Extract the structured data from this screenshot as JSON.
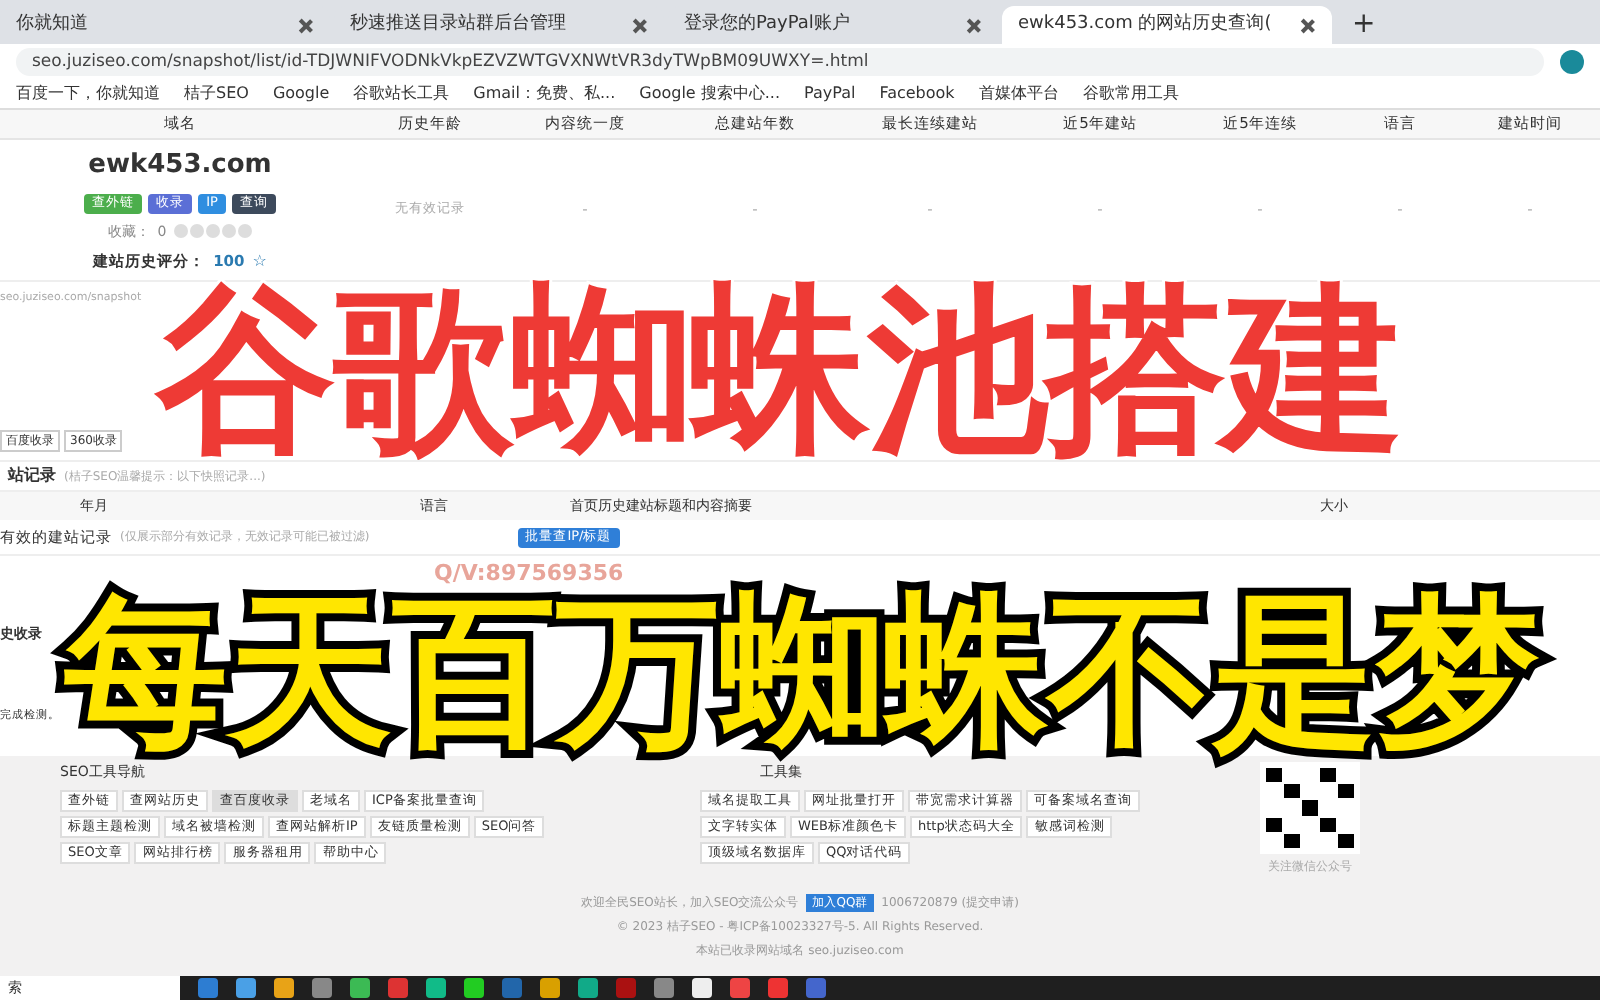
{
  "tabs": [
    {
      "title": "你就知道",
      "selected": false
    },
    {
      "title": "秒速推送目录站群后台管理",
      "selected": false
    },
    {
      "title": "登录您的PayPal账户",
      "selected": false
    },
    {
      "title": "ewk453.com 的网站历史查询(",
      "selected": true
    }
  ],
  "new_tab": "+",
  "address": "seo.juziseo.com/snapshot/list/id-TDJWNIFVODNkVkpEZVZWTGVXNWtVR3dyTWpBM09UWXY=.html",
  "bookmarks": [
    {
      "label": "百度一下，你就知道"
    },
    {
      "label": "桔子SEO"
    },
    {
      "label": "Google"
    },
    {
      "label": "谷歌站长工具"
    },
    {
      "label": "Gmail：免费、私..."
    },
    {
      "label": "Google 搜索中心..."
    },
    {
      "label": "PayPal"
    },
    {
      "label": "Facebook"
    },
    {
      "label": "首媒体平台"
    },
    {
      "label": "谷歌常用工具"
    }
  ],
  "site_table": {
    "columns": [
      "域名",
      "历史年龄",
      "内容统一度",
      "总建站年数",
      "最长连续建站",
      "近5年建站",
      "近5年连续",
      "语言",
      "建站时间"
    ],
    "domain": "ewk453.com",
    "actions": [
      {
        "label": "查外链",
        "color": "#4cae4c"
      },
      {
        "label": "收录",
        "color": "#5b6fd6"
      },
      {
        "label": "IP",
        "color": "#2f8ee0"
      },
      {
        "label": "查询",
        "color": "#3d4a5c"
      }
    ],
    "favorites_label": "收藏：",
    "favorites_count": "0",
    "stars": 0,
    "rating_label": "建站历史评分：",
    "rating": "100",
    "rating_icon": "☆",
    "status": "无有效记录",
    "cells": [
      "-",
      "-",
      "-",
      "-",
      "-",
      "-",
      "-"
    ]
  },
  "snapshot_url": "seo.juziseo.com/snapshot",
  "index_buttons": [
    "百度收录",
    "360收录"
  ],
  "record_title": "站记录",
  "record_note": "(桔子SEO温馨提示：以下快照记录...)",
  "record_columns": [
    "年月",
    "语言",
    "首页历史建站标题和内容摘要",
    "大小"
  ],
  "valid_title": "有效的建站记录",
  "valid_note": "(仅展示部分有效记录，无效记录可能已被过滤)",
  "batch_button": "批量查IP/标题",
  "history_title": "史收录",
  "done_text": "完成检测。",
  "contact": "Q/V:897569356",
  "headline": "谷歌蜘蛛池搭建",
  "subline": "每天百万蜘蛛不是梦",
  "tools_title": "SEO工具导航",
  "tools": [
    {
      "label": "查外链",
      "selected": false
    },
    {
      "label": "查网站历史",
      "selected": false
    },
    {
      "label": "查百度收录",
      "selected": true
    },
    {
      "label": "老域名",
      "selected": false
    },
    {
      "label": "ICP备案批量查询",
      "selected": false
    },
    {
      "label": "标题主题检测",
      "selected": false
    },
    {
      "label": "域名被墙检测",
      "selected": false
    },
    {
      "label": "查网站解析IP",
      "selected": false
    },
    {
      "label": "友链质量检测",
      "selected": false
    },
    {
      "label": "SEO问答",
      "selected": false
    },
    {
      "label": "SEO文章",
      "selected": false
    },
    {
      "label": "网站排行榜",
      "selected": false
    },
    {
      "label": "服务器租用",
      "selected": false
    },
    {
      "label": "帮助中心",
      "selected": false
    }
  ],
  "tools2_title": "工具集",
  "tools2": [
    {
      "label": "域名提取工具"
    },
    {
      "label": "网址批量打开"
    },
    {
      "label": "带宽需求计算器"
    },
    {
      "label": "可备案域名查询"
    },
    {
      "label": "文字转实体"
    },
    {
      "label": "WEB标准颜色卡"
    },
    {
      "label": "http状态码大全"
    },
    {
      "label": "敏感词检测"
    },
    {
      "label": "顶级域名数据库"
    },
    {
      "label": "QQ对话代码"
    }
  ],
  "qr_caption": "关注微信公众号",
  "footer": {
    "welcome": "欢迎全民SEO站长，加入SEO交流公众号",
    "qq_button": "加入QQ群",
    "qq_note": "1006720879 (提交申请)",
    "copyright": "© 2023 桔子SEO - 粤ICP备10023327号-5. All Rights Reserved.",
    "notice": "本站已收录网站域名 seo.juziseo.com"
  },
  "taskbar_label": "索"
}
